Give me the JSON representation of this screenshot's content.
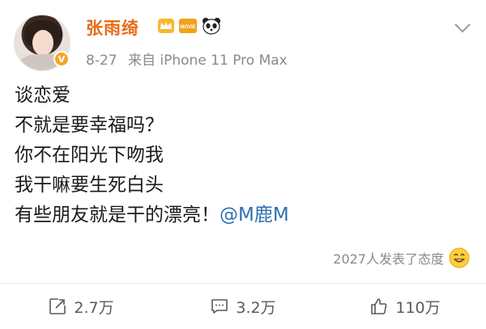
{
  "post": {
    "author": "张雨绮",
    "badge_icons": [
      "crown-icon",
      "movie-icon",
      "panda-icon"
    ],
    "movie_badge_text": "MOVIE",
    "verified_mark": "V",
    "date": "8-27",
    "source": "来自 iPhone 11 Pro Max",
    "lines": [
      "谈恋爱",
      "不就是要幸福吗？",
      "你不在阳光下吻我",
      "我干嘛要生死白头",
      "有些朋友就是干的漂亮！"
    ],
    "mention": "@M鹿M",
    "reactions_summary": "2027人发表了态度"
  },
  "actions": {
    "repost_count": "2.7万",
    "comment_count": "3.2万",
    "like_count": "110万"
  },
  "colors": {
    "username": "#e86a17",
    "mention": "#2f6fb0",
    "meta": "#8a8a8a"
  }
}
